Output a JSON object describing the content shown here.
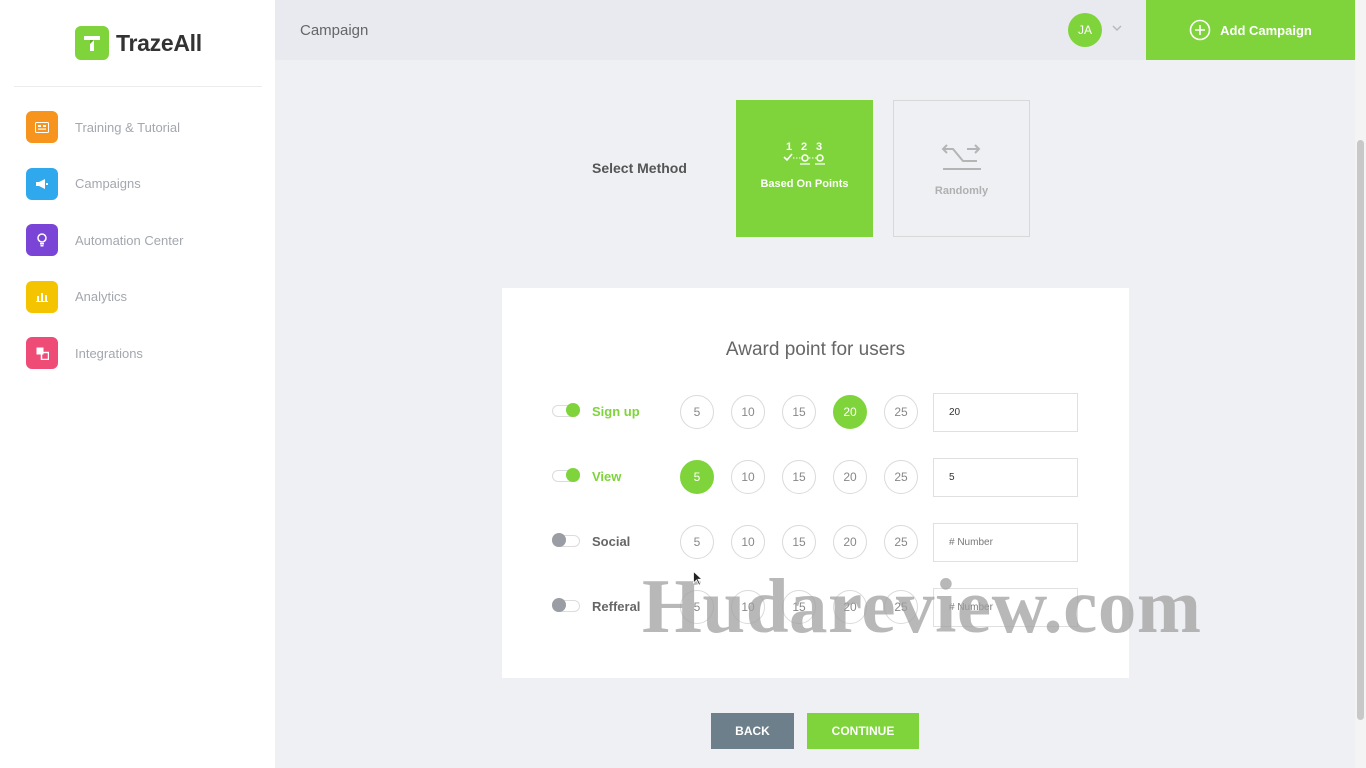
{
  "app": {
    "name": "TrazeAll"
  },
  "sidebar": {
    "items": [
      {
        "label": "Training & Tutorial",
        "icon": "training-icon",
        "color": "#f7941d"
      },
      {
        "label": "Campaigns",
        "icon": "megaphone-icon",
        "color": "#2fa8ee"
      },
      {
        "label": "Automation Center",
        "icon": "lightbulb-icon",
        "color": "#7a45d6"
      },
      {
        "label": "Analytics",
        "icon": "bar-chart-icon",
        "color": "#f5c400"
      },
      {
        "label": "Integrations",
        "icon": "integrations-icon",
        "color": "#ee4b77"
      }
    ]
  },
  "header": {
    "title": "Campaign",
    "avatar_initials": "JA",
    "add_button_label": "Add Campaign"
  },
  "method": {
    "label": "Select Method",
    "options": [
      {
        "label": "Based On Points",
        "icon": "numbered-steps-icon",
        "selected": true
      },
      {
        "label": "Randomly",
        "icon": "shuffle-icon",
        "selected": false
      }
    ]
  },
  "award": {
    "title": "Award point for users",
    "point_options": [
      "5",
      "10",
      "15",
      "20",
      "25"
    ],
    "rows": [
      {
        "label": "Sign up",
        "enabled": true,
        "selected": "20",
        "value": "20",
        "placeholder": "# Number"
      },
      {
        "label": "View",
        "enabled": true,
        "selected": "5",
        "value": "5",
        "placeholder": "# Number"
      },
      {
        "label": "Social",
        "enabled": false,
        "selected": null,
        "value": "",
        "placeholder": "# Number"
      },
      {
        "label": "Refferal",
        "enabled": false,
        "selected": null,
        "value": "",
        "placeholder": "# Number"
      }
    ]
  },
  "footer": {
    "back_label": "BACK",
    "continue_label": "CONTINUE"
  },
  "watermark": "Hudareview.com",
  "colors": {
    "accent": "#7ed43a",
    "back_button": "#6c7f8a"
  }
}
